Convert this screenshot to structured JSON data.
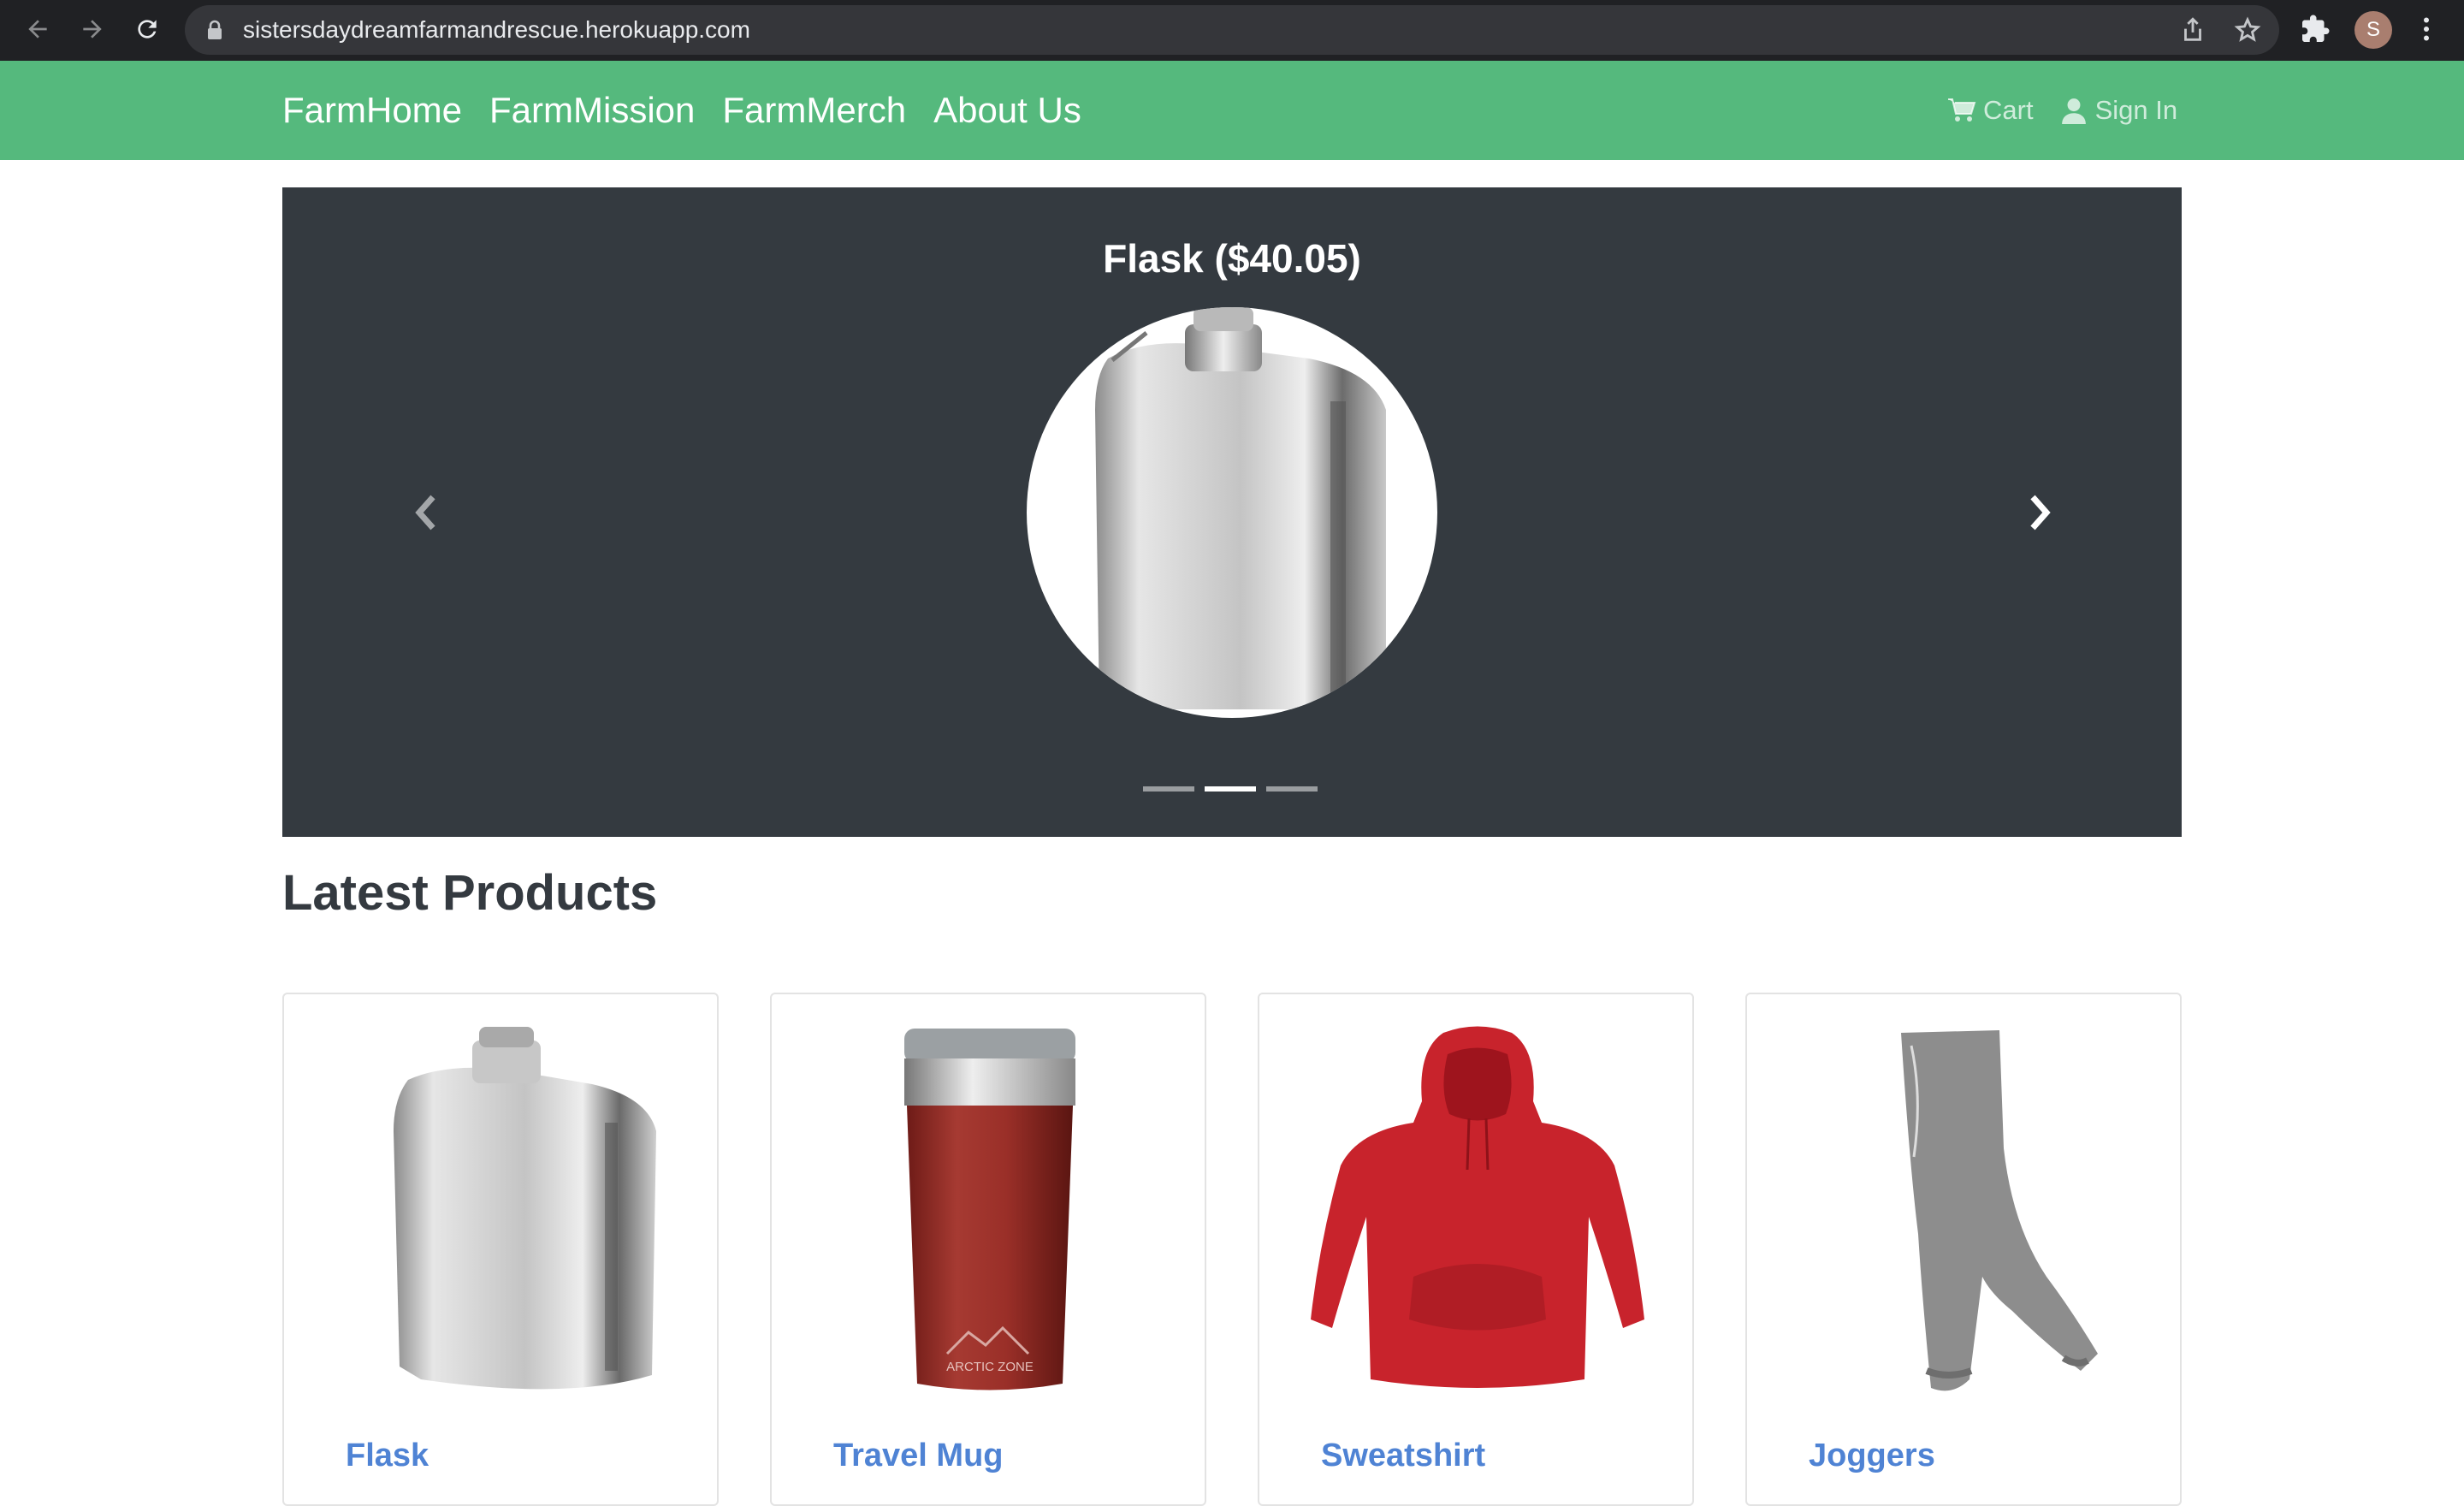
{
  "browser": {
    "url": "sistersdaydreamfarmandrescue.herokuapp.com",
    "profile_initial": "S"
  },
  "navbar": {
    "links": [
      "FarmHome",
      "FarmMission",
      "FarmMerch",
      "About Us"
    ],
    "cart_label": "Cart",
    "signin_label": "Sign In",
    "color": "#55b97d"
  },
  "carousel": {
    "title": "Flask ($40.05)",
    "slide_count": 3,
    "active_slide": 2,
    "background": "#343a40"
  },
  "latest": {
    "heading": "Latest Products",
    "products": [
      {
        "name": "Flask",
        "image": "flask"
      },
      {
        "name": "Travel Mug",
        "image": "travel-mug"
      },
      {
        "name": "Sweatshirt",
        "image": "sweatshirt"
      },
      {
        "name": "Joggers",
        "image": "joggers"
      }
    ]
  },
  "mug_print": "ARCTIC ZONE"
}
